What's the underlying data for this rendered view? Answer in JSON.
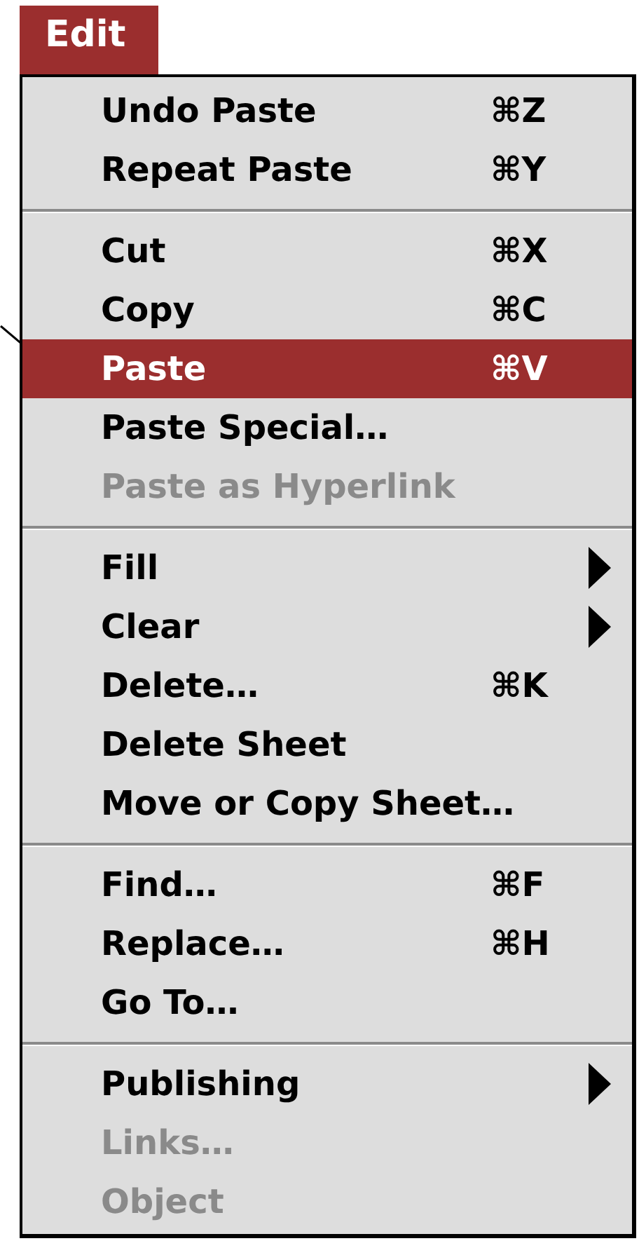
{
  "menu_title": {
    "label": "Edit",
    "selected": true
  },
  "menu_items": [
    {
      "kind": "item",
      "label": "Undo Paste",
      "shortcut": "⌘Z",
      "disabled": false,
      "selected": false,
      "submenu": false
    },
    {
      "kind": "item",
      "label": "Repeat Paste",
      "shortcut": "⌘Y",
      "disabled": false,
      "selected": false,
      "submenu": false
    },
    {
      "kind": "separator"
    },
    {
      "kind": "item",
      "label": "Cut",
      "shortcut": "⌘X",
      "disabled": false,
      "selected": false,
      "submenu": false
    },
    {
      "kind": "item",
      "label": "Copy",
      "shortcut": "⌘C",
      "disabled": false,
      "selected": false,
      "submenu": false
    },
    {
      "kind": "item",
      "label": "Paste",
      "shortcut": "⌘V",
      "disabled": false,
      "selected": true,
      "submenu": false
    },
    {
      "kind": "item",
      "label": "Paste Special…",
      "disabled": false,
      "selected": false,
      "submenu": false
    },
    {
      "kind": "item",
      "label": "Paste as Hyperlink",
      "disabled": true,
      "selected": false,
      "submenu": false
    },
    {
      "kind": "separator"
    },
    {
      "kind": "item",
      "label": "Fill",
      "disabled": false,
      "selected": false,
      "submenu": true
    },
    {
      "kind": "item",
      "label": "Clear",
      "disabled": false,
      "selected": false,
      "submenu": true
    },
    {
      "kind": "item",
      "label": "Delete…",
      "shortcut": "⌘K",
      "disabled": false,
      "selected": false,
      "submenu": false
    },
    {
      "kind": "item",
      "label": "Delete Sheet",
      "disabled": false,
      "selected": false,
      "submenu": false
    },
    {
      "kind": "item",
      "label": "Move or Copy Sheet…",
      "disabled": false,
      "selected": false,
      "submenu": false
    },
    {
      "kind": "separator"
    },
    {
      "kind": "item",
      "label": "Find…",
      "shortcut": "⌘F",
      "disabled": false,
      "selected": false,
      "submenu": false
    },
    {
      "kind": "item",
      "label": "Replace…",
      "shortcut": "⌘H",
      "disabled": false,
      "selected": false,
      "submenu": false
    },
    {
      "kind": "item",
      "label": "Go To…",
      "disabled": false,
      "selected": false,
      "submenu": false
    },
    {
      "kind": "separator"
    },
    {
      "kind": "item",
      "label": "Publishing",
      "disabled": false,
      "selected": false,
      "submenu": true
    },
    {
      "kind": "item",
      "label": "Links…",
      "disabled": true,
      "selected": false,
      "submenu": false
    },
    {
      "kind": "item",
      "label": "Object",
      "disabled": true,
      "selected": false,
      "submenu": false
    }
  ]
}
